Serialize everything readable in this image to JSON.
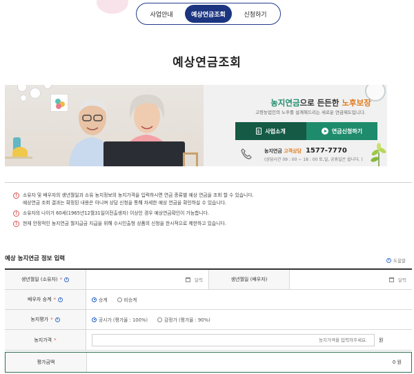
{
  "tabs": [
    {
      "label": "사업안내",
      "active": false
    },
    {
      "label": "예상연금조회",
      "active": true
    },
    {
      "label": "신청하기",
      "active": false
    }
  ],
  "page_title": "예상연금조회",
  "banner": {
    "headline_green": "농지연금",
    "headline_mid": "으로 든든한 ",
    "headline_orange": "노후보장",
    "subtitle": "고령농업인의 노후를 설계해드리는 새로운 연금제도입니다.",
    "btn_intro": "사업소개",
    "btn_apply": "연금신청하기",
    "contact_label": "농지연금",
    "contact_type": "고객상담",
    "contact_number": "1577-7770",
    "contact_hours": "(상담시간 09 : 00 ~ 18 : 00 토,일, 공휴일은 쉽니다. )"
  },
  "notes": [
    {
      "lines": [
        "소유자 및 배우자의 생년월일과 소유 농지정보의 농지가격을 입력하시면 연금 종류별 예상 연금을 조회 할 수 있습니다.",
        "예상연금 조회 결과는 확정된 내용은 아니며 상담 신청을 통해 자세한 예상 연금을 확인하실 수 있습니다."
      ]
    },
    {
      "lines": [
        "소유자의 나이가 60세(1965년12월31일이전출생자) 이상인 경우 예상연금확인이 가능합니다."
      ]
    },
    {
      "lines": [
        "현재 안정적인 농지연금 월지급금 지급을 위해 수시인출형 상품의 신청을 한시적으로 제한하고 있습니다."
      ]
    }
  ],
  "note_icon": "!",
  "form": {
    "section_title": "예상 농지연금 정보 입력",
    "help_label": "도움말",
    "birth_owner_label": "생년월일 (소유자)",
    "birth_spouse_label": "생년월일 (배우자)",
    "calendar_label": "달력",
    "spouse_succession_label": "배우자 승계",
    "spouse_options": [
      {
        "label": "승계",
        "checked": true
      },
      {
        "label": "비승계",
        "checked": false
      }
    ],
    "valuation_label": "농지평가",
    "valuation_options": [
      {
        "label": "공시가 (평가율 : 100%)",
        "checked": true
      },
      {
        "label": "감정가 (평가율 : 90%)",
        "checked": false
      }
    ],
    "price_label": "농지가격",
    "price_placeholder": "농지가격을 입력하주세요.",
    "price_unit": "원",
    "result_label": "평가금액",
    "result_value": "0 원"
  },
  "colors": {
    "primary_navy": "#1c3580",
    "brand_green": "#1e8c6c",
    "dark_green": "#145a45",
    "accent_orange": "#e07b1d",
    "required_red": "#d9534f"
  }
}
